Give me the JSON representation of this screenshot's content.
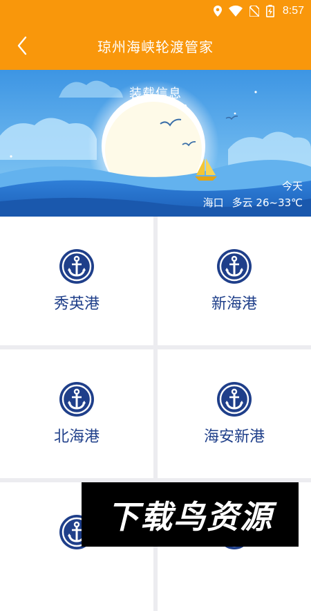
{
  "status_bar": {
    "time": "8:57",
    "icons": [
      "location-icon",
      "wifi-icon",
      "no-sim-icon",
      "battery-charging-icon"
    ]
  },
  "app_bar": {
    "back_icon": "chevron-left-icon",
    "title": "琼州海峡轮渡管家"
  },
  "banner": {
    "heading": "装载信息",
    "day": "今天",
    "city": "海口",
    "weather": "多云 26~33℃"
  },
  "ports": [
    {
      "name": "秀英港",
      "icon": "anchor-icon"
    },
    {
      "name": "新海港",
      "icon": "anchor-icon"
    },
    {
      "name": "北海港",
      "icon": "anchor-icon"
    },
    {
      "name": "海安新港",
      "icon": "anchor-icon"
    },
    {
      "name": "",
      "icon": "anchor-icon"
    },
    {
      "name": "",
      "icon": "anchor-icon"
    }
  ],
  "watermark": "下载鸟资源",
  "colors": {
    "brand_orange": "#f9970b",
    "port_blue": "#1f3f8a",
    "sky_blue": "#4aa3ea"
  }
}
